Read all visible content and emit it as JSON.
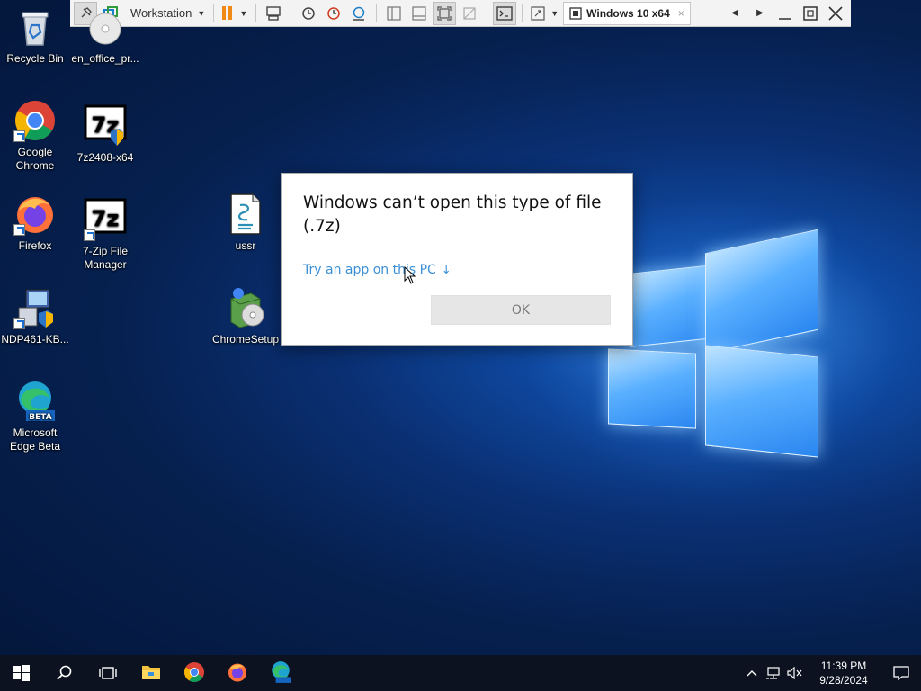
{
  "vm_toolbar": {
    "menu_label": "Workstation",
    "vm_tab_label": "Windows 10 x64",
    "vm_tab_close": "×"
  },
  "desktop_icons": [
    {
      "label": "Recycle Bin"
    },
    {
      "label": "en_office_pr..."
    },
    {
      "label": "Google Chrome"
    },
    {
      "label": "7z2408-x64"
    },
    {
      "label": "Firefox"
    },
    {
      "label": "7-Zip File Manager"
    },
    {
      "label": "ussr"
    },
    {
      "label": "NDP461-KB..."
    },
    {
      "label": "ChromeSetup"
    },
    {
      "label": "Microsoft Edge Beta"
    }
  ],
  "dialog": {
    "title": "Windows can’t open this type of file (.7z)",
    "link": "Try an app on this PC",
    "link_arrow": "↓",
    "ok_label": "OK"
  },
  "taskbar": {
    "time": "11:39 PM",
    "date": "9/28/2024",
    "tray_chevron": "^"
  },
  "colors": {
    "link": "#3b8fd6",
    "vm_pause": "#f08a14",
    "taskbar_bg": "#0c1220"
  }
}
